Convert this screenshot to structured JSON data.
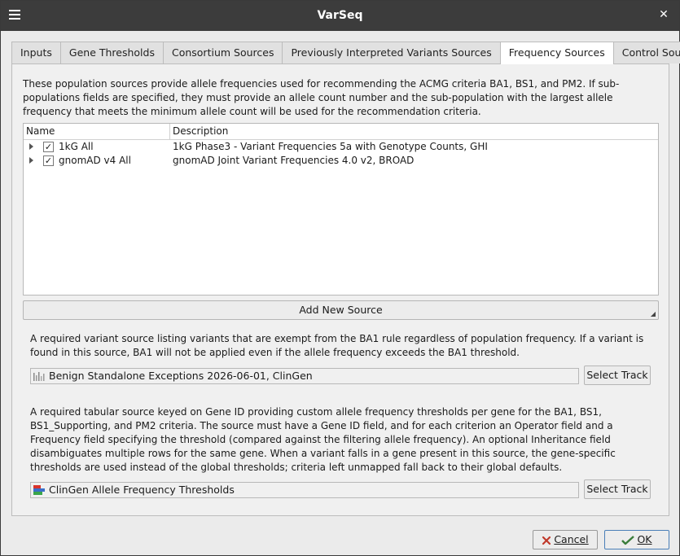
{
  "window": {
    "title": "VarSeq"
  },
  "tabs": [
    {
      "label": "Inputs"
    },
    {
      "label": "Gene Thresholds"
    },
    {
      "label": "Consortium Sources"
    },
    {
      "label": "Previously Interpreted Variants Sources"
    },
    {
      "label": "Frequency Sources",
      "active": true
    },
    {
      "label": "Control Sources"
    }
  ],
  "intro_text": "These population sources provide allele frequencies used for recommending the ACMG criteria BA1, BS1, and PM2. If sub-populations fields are specified, they must provide an allele count number and the sub-population with the largest allele frequency that meets the minimum allele count will be used for the recommendation criteria.",
  "table": {
    "columns": [
      "Name",
      "Description"
    ],
    "rows": [
      {
        "name": "1kG All",
        "description": "1kG Phase3 - Variant Frequencies 5a with Genotype Counts, GHI",
        "checked": true
      },
      {
        "name": "gnomAD  v4 All",
        "description": "gnomAD Joint Variant Frequencies 4.0 v2, BROAD",
        "checked": true
      }
    ]
  },
  "add_source_label": "Add New Source",
  "exceptions": {
    "text": "A required variant source listing variants that are exempt from the BA1 rule regardless of population frequency. If a variant is found in this source, BA1 will not be applied even if the allele frequency exceeds the BA1 threshold.",
    "track": "Benign Standalone Exceptions 2026-06-01, ClinGen",
    "button": "Select Track"
  },
  "thresholds": {
    "text": "A required tabular source keyed on Gene ID providing custom allele frequency thresholds per gene for the BA1, BS1, BS1_Supporting, and PM2 criteria. The source must have a Gene ID field, and for each criterion an Operator field and a Frequency field specifying the threshold (compared against the filtering allele frequency). An optional Inheritance field disambiguates multiple rows for the same gene. When a variant falls in a gene present in this source, the gene-specific thresholds are used instead of the global thresholds; criteria left unmapped fall back to their global defaults.",
    "track": "ClinGen Allele Frequency Thresholds",
    "button": "Select Track"
  },
  "footer": {
    "cancel": "Cancel",
    "ok": "OK"
  },
  "check_mark": "✓"
}
